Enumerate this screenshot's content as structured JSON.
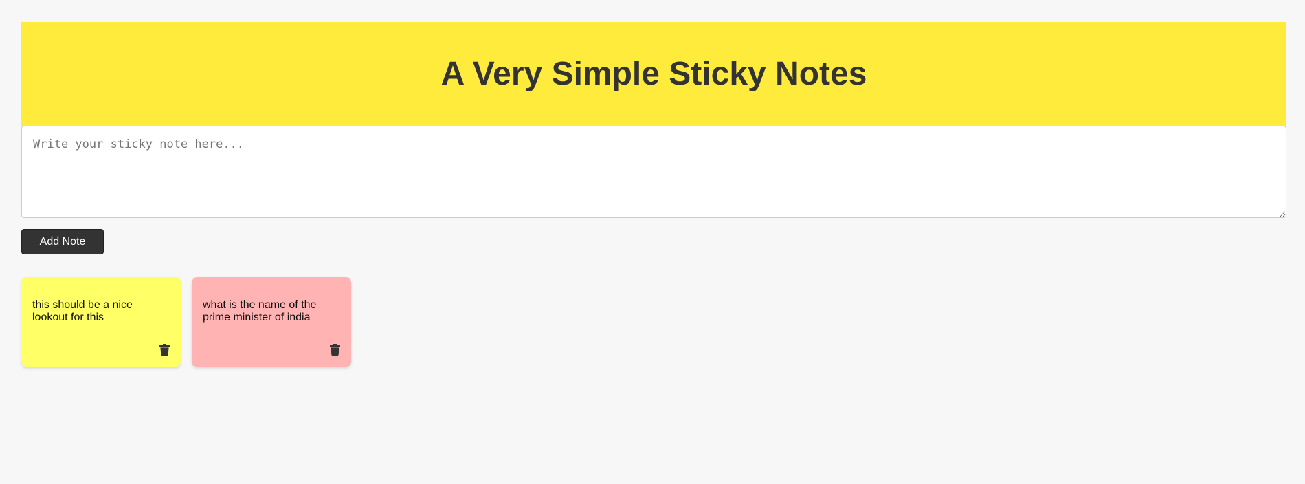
{
  "header": {
    "title": "A Very Simple Sticky Notes",
    "background_color": "#ffeb3b"
  },
  "editor": {
    "placeholder": "Write your sticky note here...",
    "value": ""
  },
  "actions": {
    "add_label": "Add Note"
  },
  "notes": [
    {
      "text": "this should be a nice lookout for this",
      "color": "#ffff66",
      "delete_icon": "trash-icon"
    },
    {
      "text": "what is the name of the prime minister of india",
      "color": "#ffb3b3",
      "delete_icon": "trash-icon"
    }
  ]
}
